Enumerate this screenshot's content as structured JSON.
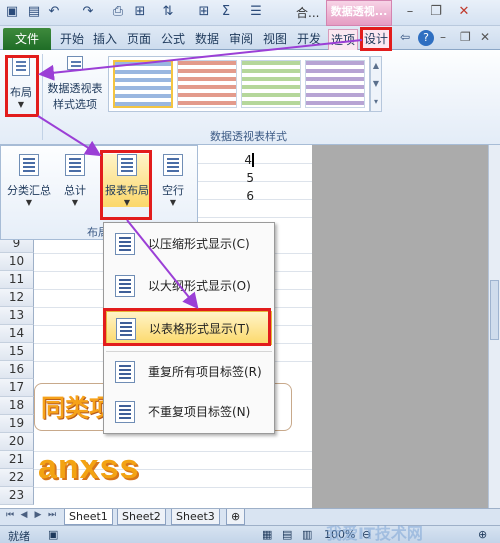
{
  "title_bar": {
    "context_title": "数据透视...",
    "window_title": "合..."
  },
  "tabs": [
    {
      "label": "文件"
    },
    {
      "label": "开始"
    },
    {
      "label": "插入"
    },
    {
      "label": "页面"
    },
    {
      "label": "公式"
    },
    {
      "label": "数据"
    },
    {
      "label": "审阅"
    },
    {
      "label": "视图"
    },
    {
      "label": "开发"
    },
    {
      "label": "选项"
    },
    {
      "label": "设计"
    }
  ],
  "ribbon": {
    "layout_button": "布局",
    "pivot_options_line1": "数据透视表",
    "pivot_options_line2": "样式选项",
    "styles_group_label": "数据透视表样式"
  },
  "layout_panel": {
    "subtotals": "分类汇总",
    "grand_totals": "总计",
    "report_layout": "报表布局",
    "blank_rows": "空行",
    "group_label": "布局"
  },
  "report_layout_menu": [
    {
      "label": "以压缩形式显示(C)"
    },
    {
      "label": "以大纲形式显示(O)"
    },
    {
      "label": "以表格形式显示(T)"
    },
    {
      "label": "重复所有项目标签(R)"
    },
    {
      "label": "不重复项目标签(N)"
    }
  ],
  "rows": [
    {
      "n": "9"
    },
    {
      "n": "10"
    },
    {
      "n": "11"
    },
    {
      "n": "12"
    },
    {
      "n": "13"
    },
    {
      "n": "14"
    },
    {
      "n": "15"
    },
    {
      "n": "16"
    },
    {
      "n": "17"
    },
    {
      "n": "18"
    },
    {
      "n": "19"
    },
    {
      "n": "20"
    },
    {
      "n": "21"
    },
    {
      "n": "22"
    },
    {
      "n": "23"
    }
  ],
  "cells": [
    "4",
    "5",
    "6"
  ],
  "art_text_1": "同类项",
  "art_text_2": "anxss",
  "sheet_tabs": [
    "Sheet1",
    "Sheet2",
    "Sheet3"
  ],
  "status": {
    "ready": "就绪",
    "zoom": "100%"
  },
  "watermark": "我爱IT技术网"
}
